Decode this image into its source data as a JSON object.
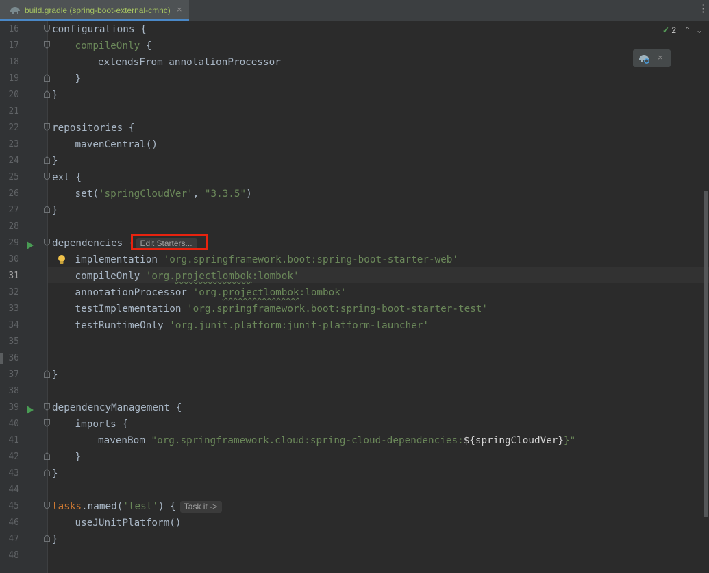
{
  "tab": {
    "title": "build.gradle (spring-boot-external-cmnc)",
    "close": "×",
    "menu": "⋮"
  },
  "inspection": {
    "count": "2",
    "check": "✓",
    "chevron_up": "⌃",
    "chevron_down": "⌄"
  },
  "gradle_popup": {
    "close": "×"
  },
  "colors": {
    "keyword": "#cc7832",
    "string": "#6a8759",
    "text": "#a9b7c6",
    "highlight": "#e8230f"
  },
  "lines": [
    {
      "n": "16",
      "code": "configurations {"
    },
    {
      "n": "17",
      "a": "compileOnly",
      "b": " {"
    },
    {
      "n": "18",
      "code": "extendsFrom annotationProcessor"
    },
    {
      "n": "19",
      "code": "}"
    },
    {
      "n": "20",
      "code": "}"
    },
    {
      "n": "21",
      "code": ""
    },
    {
      "n": "22",
      "code": "repositories {"
    },
    {
      "n": "23",
      "code": "mavenCentral()"
    },
    {
      "n": "24",
      "code": "}"
    },
    {
      "n": "25",
      "code": "ext {"
    },
    {
      "n": "26",
      "a": "set(",
      "s1": "'springCloudVer'",
      "b": ", ",
      "s2": "\"3.3.5\"",
      "c": ")"
    },
    {
      "n": "27",
      "code": "}"
    },
    {
      "n": "28",
      "code": ""
    },
    {
      "n": "29",
      "a": "dependencies {",
      "hint": "Edit Starters..."
    },
    {
      "n": "30",
      "a": "implementation ",
      "s": "'org.springframework.boot:spring-boot-starter-web'"
    },
    {
      "n": "31",
      "a": "compileOnly ",
      "s1": "'org.",
      "u": "projectlombok",
      "s2": ":lombok'"
    },
    {
      "n": "32",
      "a": "annotationProcessor ",
      "s1": "'org.",
      "u": "projectlombok",
      "s2": ":lombok'"
    },
    {
      "n": "33",
      "a": "testImplementation ",
      "s": "'org.springframework.boot:spring-boot-starter-test'"
    },
    {
      "n": "34",
      "a": "testRuntimeOnly ",
      "s": "'org.junit.platform:junit-platform-launcher'"
    },
    {
      "n": "35",
      "code": ""
    },
    {
      "n": "36",
      "code": ""
    },
    {
      "n": "37",
      "code": "}"
    },
    {
      "n": "38",
      "code": ""
    },
    {
      "n": "39",
      "code": "dependencyManagement {"
    },
    {
      "n": "40",
      "code": "imports {"
    },
    {
      "n": "41",
      "u": "mavenBom",
      "s1": " \"org.springframework.cloud:spring-cloud-dependencies:",
      "v": "${springCloudVer}",
      "s2": "}\""
    },
    {
      "n": "42",
      "code": "}"
    },
    {
      "n": "43",
      "code": "}"
    },
    {
      "n": "44",
      "code": ""
    },
    {
      "n": "45",
      "k": "tasks",
      "a": ".named(",
      "s": "'test'",
      "b": ") {",
      "hint": "Task it ->"
    },
    {
      "n": "46",
      "u": "useJUnitPlatform",
      "b": "()"
    },
    {
      "n": "47",
      "code": "}"
    },
    {
      "n": "48",
      "code": ""
    }
  ]
}
